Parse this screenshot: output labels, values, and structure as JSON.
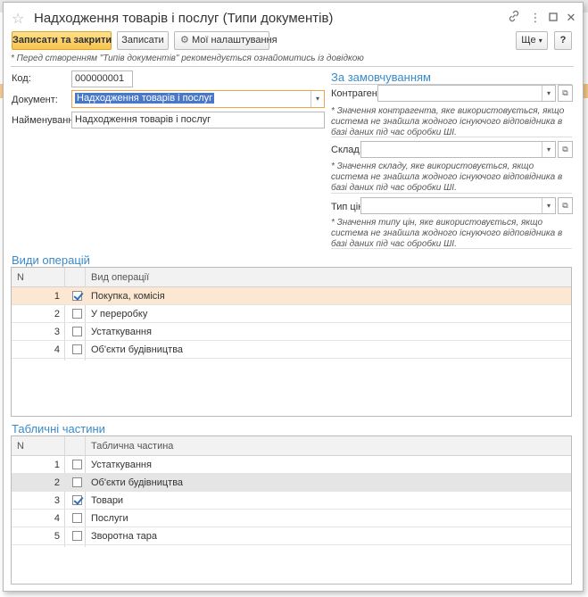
{
  "window": {
    "title": "Надходження товарів і послуг (Типи документів)"
  },
  "toolbar": {
    "save_close_label": "Записати та закрити",
    "save_label": "Записати",
    "settings_label": "Мої налаштування",
    "more_label": "Ще",
    "help_label": "?"
  },
  "notice": "* Перед створенням \"Типів документів\" рекомендується ознайомитись із довідкою",
  "form": {
    "code_label": "Код:",
    "code_value": "000000001",
    "document_label": "Документ:",
    "document_value": "Надходження товарів і послуг",
    "name_label": "Найменування:",
    "name_value": "Надходження товарів і послуг"
  },
  "defaults": {
    "title": "За замовчуванням",
    "counterparty_label": "Контрагент:",
    "counterparty_value": "",
    "counterparty_hint": "* Значення контрагента, яке використовується, якщо система не знайшла жодного існуючого відповідника в базі даних під час обробки ШІ.",
    "warehouse_label": "Склад:",
    "warehouse_value": "",
    "warehouse_hint": "* Значення складу, яке використовується, якщо система не знайшла жодного існуючого відповідника в базі даних під час обробки ШІ.",
    "price_type_label": "Тип цін:",
    "price_type_value": "",
    "price_type_hint": "* Значення типу цін, яке використовується, якщо система не знайшла жодного існуючого відповідника в базі даних під час обробки ШІ."
  },
  "operations": {
    "title": "Види операцій",
    "col_n": "N",
    "col_name": "Вид операції",
    "rows": [
      {
        "n": "1",
        "checked": true,
        "name": "Покупка, комісія"
      },
      {
        "n": "2",
        "checked": false,
        "name": "У переробку"
      },
      {
        "n": "3",
        "checked": false,
        "name": "Устаткування"
      },
      {
        "n": "4",
        "checked": false,
        "name": "Об'єкти будівництва"
      }
    ]
  },
  "tabular": {
    "title": "Табличні частини",
    "col_n": "N",
    "col_name": "Таблична частина",
    "rows": [
      {
        "n": "1",
        "checked": false,
        "name": "Устаткування"
      },
      {
        "n": "2",
        "checked": false,
        "name": "Об'єкти будівництва"
      },
      {
        "n": "3",
        "checked": true,
        "name": "Товари"
      },
      {
        "n": "4",
        "checked": false,
        "name": "Послуги"
      },
      {
        "n": "5",
        "checked": false,
        "name": "Зворотна тара"
      }
    ]
  },
  "colors": {
    "accent": "#3a8ac9",
    "primary_button": "#f6c44f",
    "selected_row": "#fbe7d2"
  }
}
